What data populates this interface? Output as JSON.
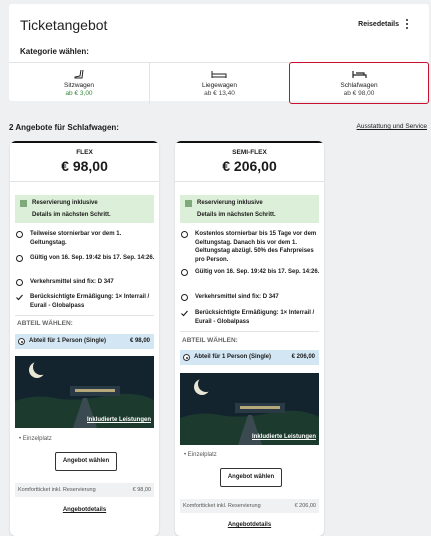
{
  "header": {
    "title": "Ticketangebot",
    "reisedetails": "Reisedetails"
  },
  "kategorie": {
    "label": "Kategorie wählen:",
    "items": [
      {
        "name": "Sitzwagen",
        "price": "ab € 3,00",
        "icon": "seat-icon"
      },
      {
        "name": "Liegewagen",
        "price": "ab € 13,40",
        "icon": "couchette-icon"
      },
      {
        "name": "Schlafwagen",
        "price": "ab € 98,00",
        "icon": "bed-icon"
      }
    ]
  },
  "offers_heading": "2 Angebote für Schlafwagen:",
  "ausstattung": "Ausstattung und Service",
  "offers": [
    {
      "name": "FLEX",
      "price": "€ 98,00",
      "reservation_1": "Reservierung inklusive",
      "reservation_2": "Details im nächsten Schritt.",
      "features": [
        "Teilweise stornierbar vor dem 1. Geltungstag.",
        "Gültig von 16. Sep. 19:42 bis 17. Sep. 14:26.",
        "Verkehrsmittel sind fix: D 347",
        "Berücksichtigte Ermäßigung: 1× Interrail / Eurail - Globalpass"
      ],
      "abteil_label": "ABTEIL WÄHLEN:",
      "option_label": "Abteil für 1 Person (Single)",
      "option_price": "€ 98,00",
      "image_link": "Inkludierte Leistungen",
      "einzelplatz": "Einzelplatz",
      "button": "Angebot wählen",
      "komfort_label": "Komfortticket inkl. Reservierung",
      "komfort_price": "€ 98,00",
      "details": "Angebotdetails"
    },
    {
      "name": "SEMI-FLEX",
      "price": "€ 206,00",
      "reservation_1": "Reservierung inklusive",
      "reservation_2": "Details im nächsten Schritt.",
      "features": [
        "Kostenlos stornierbar bis 15 Tage vor dem Geltungstag. Danach bis vor dem 1. Geltungstag abzügl. 50% des Fahrpreises pro Person.",
        "Gültig von 16. Sep. 19:42 bis 17. Sep. 14:26.",
        "Verkehrsmittel sind fix: D 347",
        "Berücksichtigte Ermäßigung: 1× Interrail / Eurail - Globalpass"
      ],
      "abteil_label": "ABTEIL WÄHLEN:",
      "option_label": "Abteil für 1 Person (Single)",
      "option_price": "€ 206,00",
      "image_link": "Inkludierte Leistungen",
      "einzelplatz": "Einzelplatz",
      "button": "Angebot wählen",
      "komfort_label": "Komfortticket inkl. Reservierung",
      "komfort_price": "€ 206,00",
      "details": "Angebotdetails"
    }
  ],
  "colors": {
    "accent": "#c8102e",
    "green_price": "#3a8a3a",
    "reservation_bg": "#dcefd8",
    "option_bg": "#d3e6f3"
  }
}
